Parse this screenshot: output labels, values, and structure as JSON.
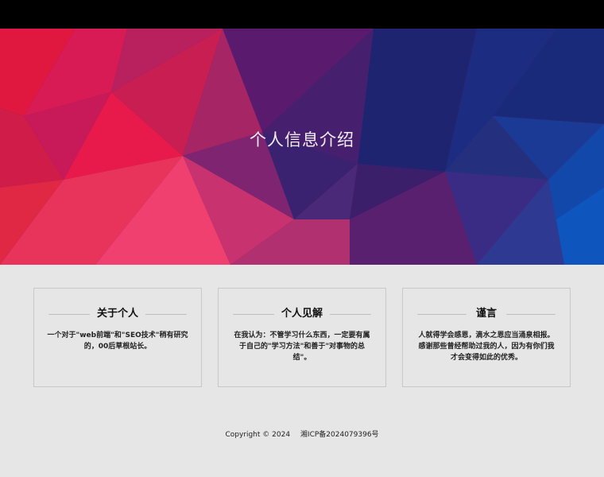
{
  "hero": {
    "title": "个人信息介绍"
  },
  "cards": [
    {
      "title": "关于个人",
      "text": "一个对于\"web前端\"和\"SEO技术\"稍有研究的，00后草根站长。"
    },
    {
      "title": "个人见解",
      "text": "在我认为：不管学习什么东西，一定要有属于自己的\"学习方法\"和善于\"对事物的总结\"。"
    },
    {
      "title": "谨言",
      "text": "人就得学会感恩，滴水之恩应当涌泉相报。感谢那些曾经帮助过我的人，因为有你们我才会变得如此的优秀。"
    }
  ],
  "footer": {
    "copyright": "Copyright © 2024",
    "icp": "湘ICP备2024079396号"
  },
  "colors": {
    "topbar": "#000000",
    "content_bg": "#e6e6e6",
    "card_border": "#c9c9c9"
  }
}
